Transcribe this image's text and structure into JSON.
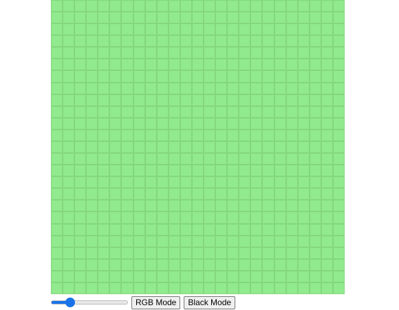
{
  "canvas": {
    "cells_per_side": 25,
    "cell_color": "#91ea8d",
    "grid_line_color": "#84d67f"
  },
  "controls": {
    "size_slider": {
      "min": 1,
      "max": 100,
      "value": 22,
      "accent_color": "#1a73e8"
    },
    "rgb_button_label": "RGB Mode",
    "black_button_label": "Black Mode"
  }
}
